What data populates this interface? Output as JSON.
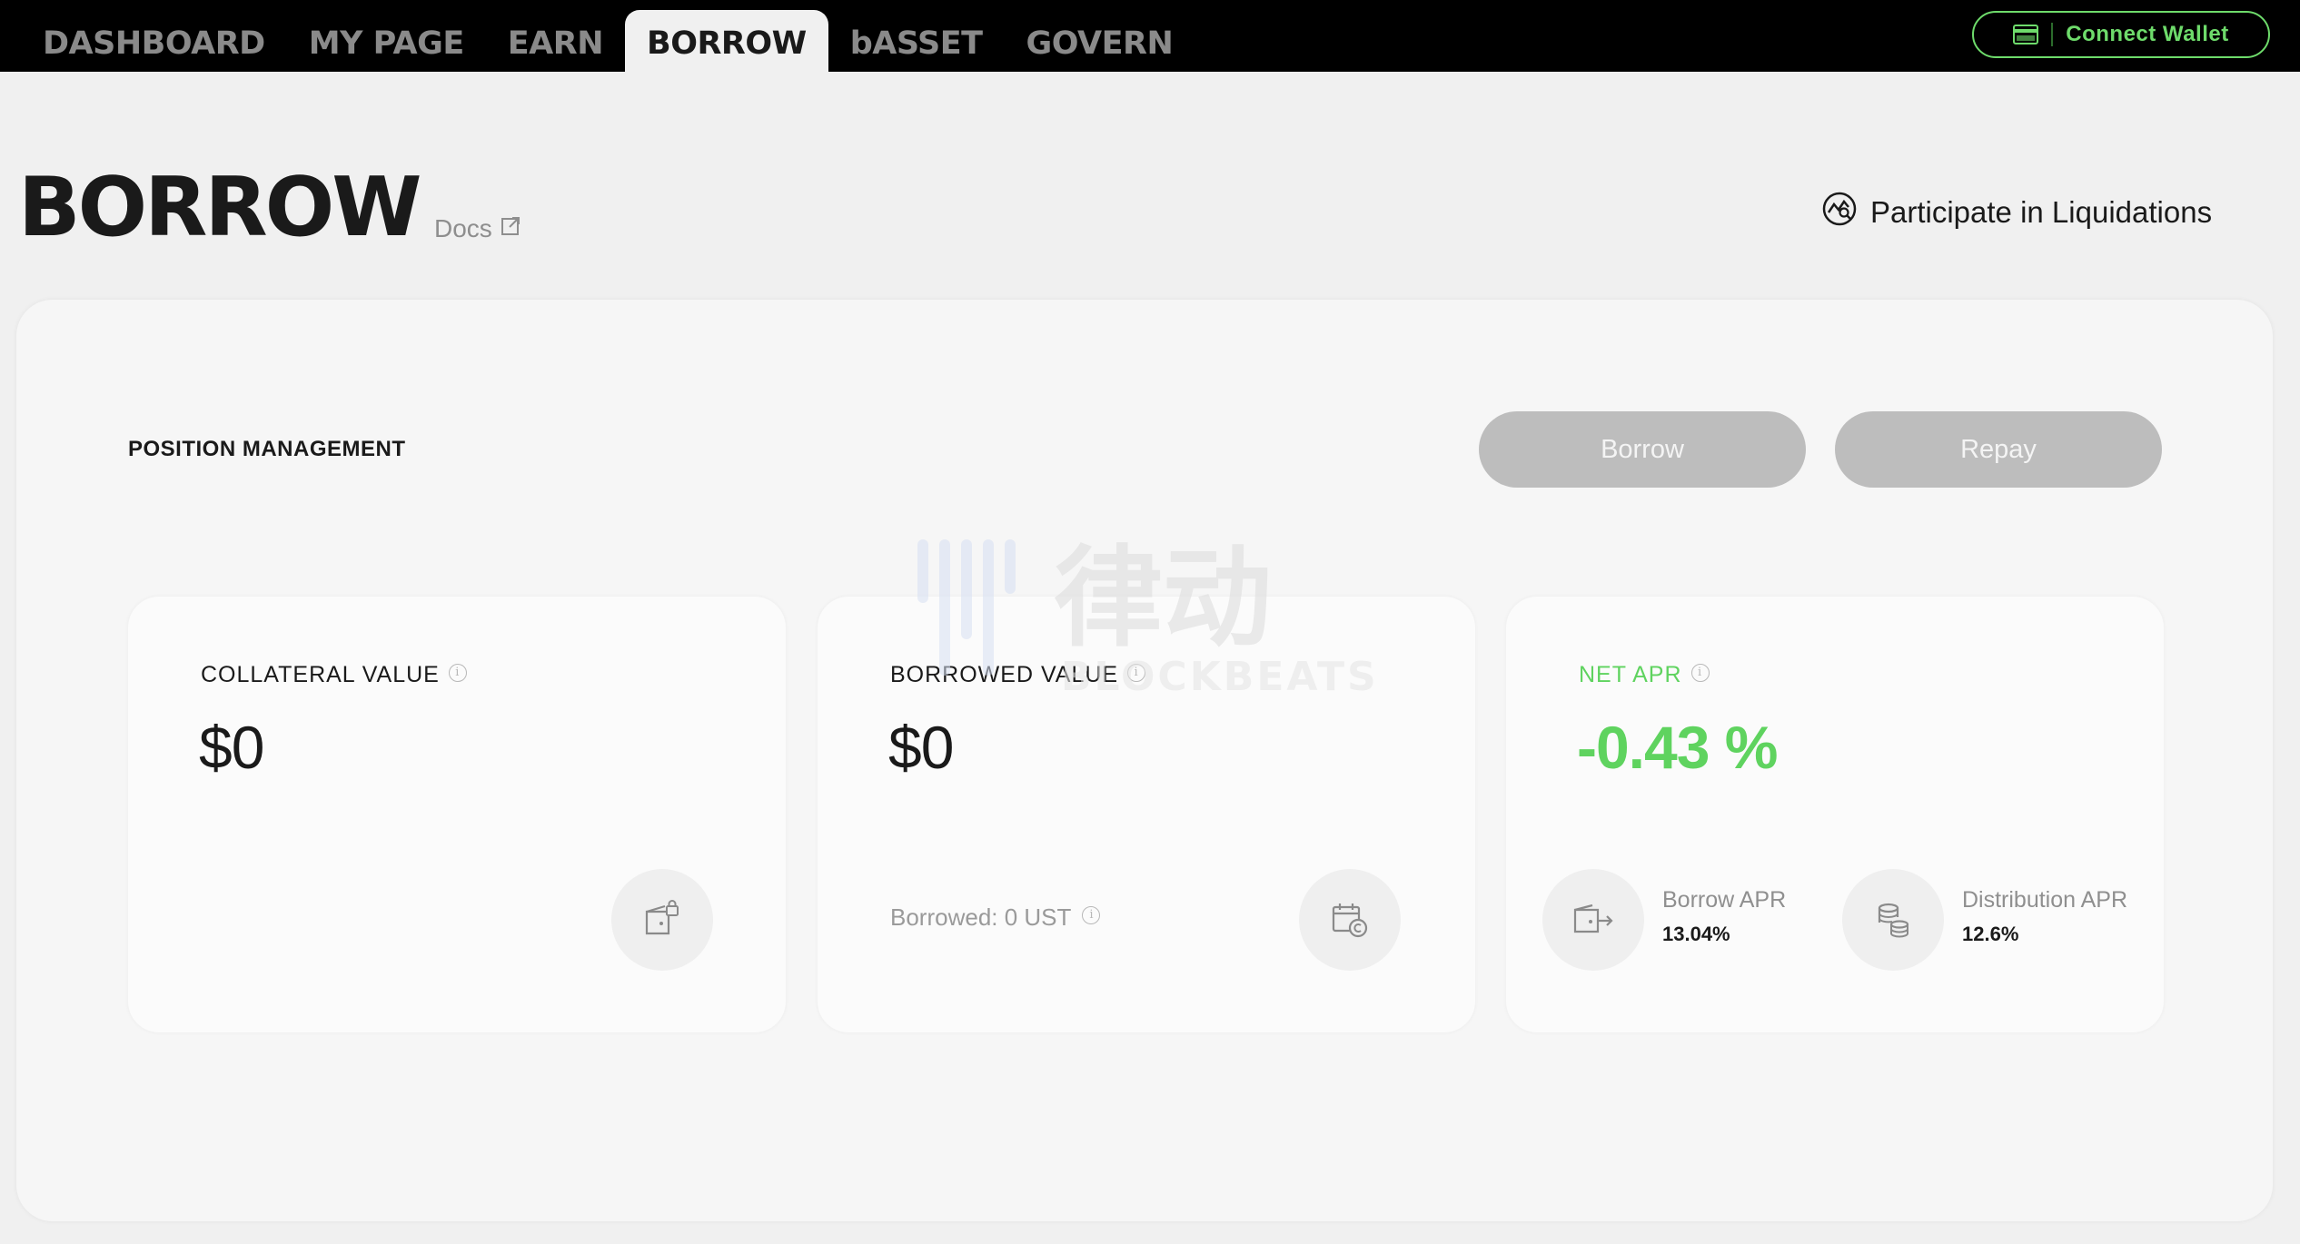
{
  "nav": {
    "tabs": [
      {
        "label": "DASHBOARD"
      },
      {
        "label": "MY PAGE"
      },
      {
        "label": "EARN"
      },
      {
        "label": "BORROW"
      },
      {
        "label": "bASSET"
      },
      {
        "label": "GOVERN"
      }
    ],
    "active_tab": "BORROW",
    "connect_wallet_label": "Connect Wallet"
  },
  "page": {
    "title": "BORROW",
    "docs_label": "Docs",
    "liquidations_label": "Participate in Liquidations"
  },
  "position_management": {
    "title": "POSITION MANAGEMENT",
    "borrow_label": "Borrow",
    "repay_label": "Repay"
  },
  "cards": {
    "collateral": {
      "label": "COLLATERAL VALUE",
      "value": "$0"
    },
    "borrowed": {
      "label": "BORROWED VALUE",
      "value": "$0",
      "borrowed_line": "Borrowed: 0 UST"
    },
    "net_apr": {
      "label": "NET APR",
      "value": "-0.43 %",
      "borrow_apr_label": "Borrow APR",
      "borrow_apr_value": "13.04%",
      "distribution_apr_label": "Distribution APR",
      "distribution_apr_value": "12.6%"
    }
  },
  "watermark": {
    "cn_text": "律动",
    "en_text": "BLOCKBEATS"
  },
  "colors": {
    "accent_green": "#5fd35f",
    "wallet_green": "#6edb6b",
    "nav_bg": "#000000",
    "button_disabled": "#bdbdbd"
  },
  "icons": {
    "wallet": "wallet-icon",
    "docs_external": "external-link-icon",
    "liquidations": "liquidation-chart-icon",
    "collateral": "wallet-lock-icon",
    "borrowed": "calendar-coin-icon",
    "borrow_apr": "wallet-arrow-icon",
    "distribution_apr": "coin-stack-icon"
  }
}
